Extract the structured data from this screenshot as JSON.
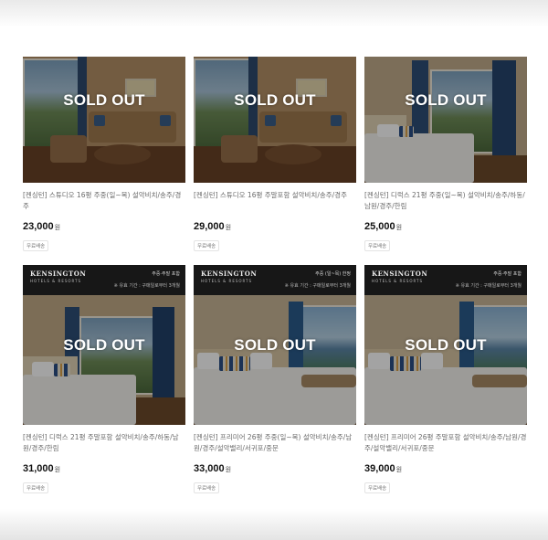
{
  "sold_out_label": "SOLD OUT",
  "banner": {
    "brand": "KENSINGTON",
    "brand_sub": "HOTELS & RESORTS"
  },
  "products": [
    {
      "title": "[켄싱턴] 스튜디오 16평 주중(일~목) 설악비치/송주/경주",
      "price": "23,000",
      "unit": "원",
      "shipping": "무료배송",
      "sold_out": true,
      "image": "living-room"
    },
    {
      "title": "[켄싱턴] 스튜디오 16평 주말포함 설악비치/송주/경주",
      "price": "29,000",
      "unit": "원",
      "shipping": "무료배송",
      "sold_out": true,
      "image": "living-room"
    },
    {
      "title": "[켄싱턴] 디럭스 21평 주중(일~목) 설악비치/송주/하동/남원/경주/한림",
      "price": "25,000",
      "unit": "원",
      "shipping": "무료배송",
      "sold_out": true,
      "image": "bedroom-view"
    },
    {
      "title": "[켄싱턴] 디럭스 21평 주말포함 설악비치/송주/하동/남원/경주/한림",
      "price": "31,000",
      "unit": "원",
      "shipping": "무료배송",
      "sold_out": true,
      "image": "bedroom-view",
      "banner_promo": "주중·주말 포함",
      "banner_promo2": "※ 유효 기간 : 구매일로부터 3개월"
    },
    {
      "title": "[켄싱턴] 프리미어 26평 주중(일~목) 설악비치/송주/남원/경주/설악밸리/서귀포/중문",
      "price": "33,000",
      "unit": "원",
      "shipping": "무료배송",
      "sold_out": true,
      "image": "premier-bedroom",
      "banner_promo": "주중 (일~목) 한정",
      "banner_promo2": "※ 유효 기간 : 구매일로부터 3개월"
    },
    {
      "title": "[켄싱턴] 프리미어 26평 주말포함 설악비치/송주/남원/경주/설악밸리/서귀포/중문",
      "price": "39,000",
      "unit": "원",
      "shipping": "무료배송",
      "sold_out": true,
      "image": "premier-bedroom",
      "banner_promo": "주중·주말 포함",
      "banner_promo2": "※ 유효 기간 : 구매일로부터 3개월"
    }
  ]
}
